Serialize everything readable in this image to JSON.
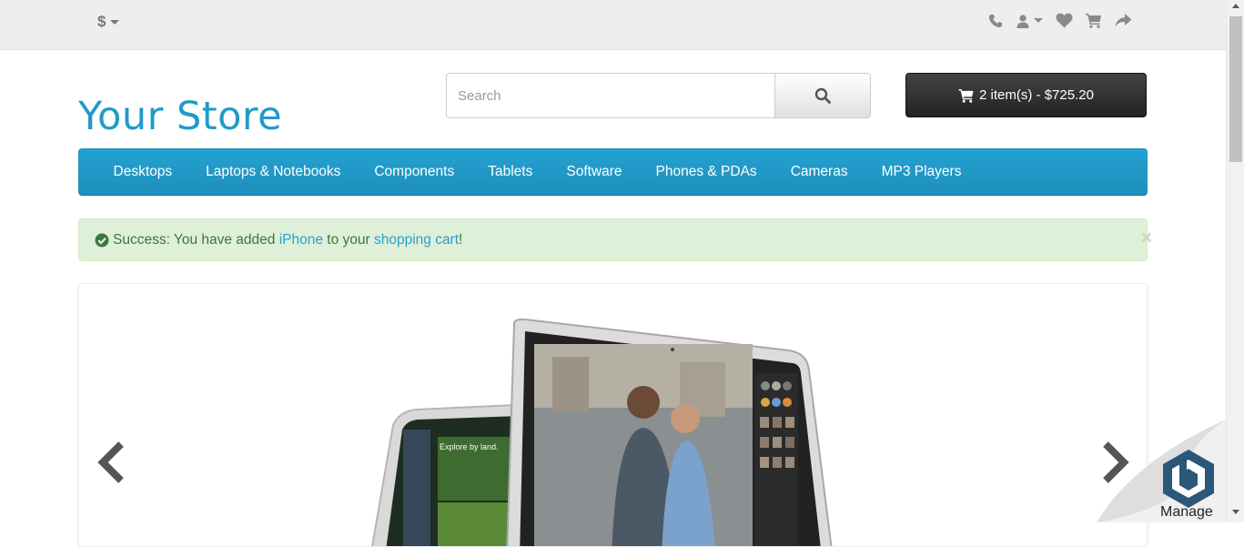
{
  "topbar": {
    "currency_symbol": "$",
    "icons": [
      "phone-icon",
      "user-icon",
      "heart-icon",
      "shopping-cart-icon",
      "share-icon"
    ]
  },
  "header": {
    "logo_text": "Your Store",
    "search_placeholder": "Search",
    "cart_label": "2 item(s) - $725.20"
  },
  "menu": {
    "items": [
      "Desktops",
      "Laptops & Notebooks",
      "Components",
      "Tablets",
      "Software",
      "Phones & PDAs",
      "Cameras",
      "MP3 Players"
    ]
  },
  "alert": {
    "prefix": "Success: You have added ",
    "product_link": "iPhone",
    "middle": " to your ",
    "cart_link": "shopping cart",
    "suffix": "!",
    "close": "×"
  },
  "slider": {
    "image": "macbook-air-banner"
  },
  "widget": {
    "label": "Manage"
  },
  "colors": {
    "brand": "#229ac8",
    "menu_bg": "#229ac8",
    "alert_bg": "#dff0d8",
    "alert_text": "#3c763d",
    "cart_bg": "#333333"
  }
}
